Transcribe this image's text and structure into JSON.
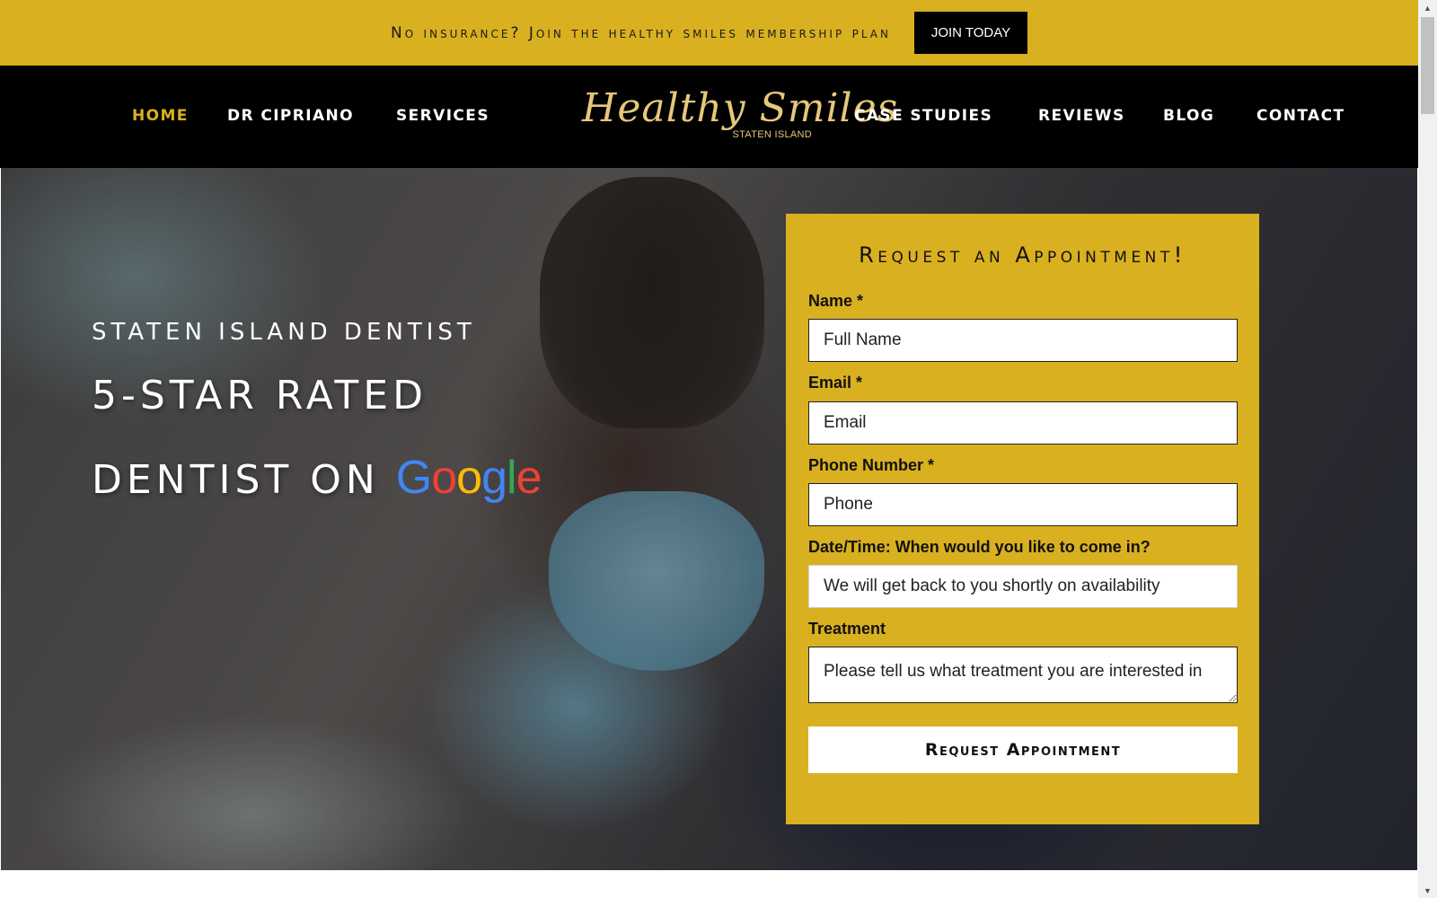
{
  "banner": {
    "text": "No insurance? Join the healthy smiles membership plan",
    "cta_label": "JOIN TODAY"
  },
  "nav": {
    "left_items": [
      {
        "label": "HOME",
        "active": true
      },
      {
        "label": "DR CIPRIANO"
      },
      {
        "label": "SERVICES"
      }
    ],
    "logo": {
      "script": "Healthy Smiles",
      "sub": "STATEN ISLAND"
    },
    "right_items": [
      {
        "label": "CASE STUDIES"
      },
      {
        "label": "REVIEWS"
      },
      {
        "label": "BLOG"
      },
      {
        "label": "CONTACT"
      }
    ]
  },
  "hero": {
    "eyebrow": "Staten Island Dentist",
    "line1": "5-Star Rated",
    "line2": "Dentist on",
    "google": [
      "G",
      "o",
      "o",
      "g",
      "l",
      "e"
    ]
  },
  "form": {
    "title": "Request an Appointment!",
    "name_label": "Name *",
    "name_placeholder": "Full Name",
    "email_label": "Email *",
    "email_placeholder": "Email",
    "phone_label": "Phone Number *",
    "phone_placeholder": "Phone",
    "datetime_label": "Date/Time: When would you like to come in?",
    "datetime_placeholder": "We will get back to you shortly on availability",
    "treatment_label": "Treatment",
    "treatment_placeholder": "Please tell us what treatment you are interested in",
    "submit_label": "Request Appointment"
  },
  "colors": {
    "accent": "#d9b01f",
    "nav_bg": "#000000",
    "google_blue": "#4285F4",
    "google_red": "#EA4335",
    "google_yellow": "#FBBC05",
    "google_green": "#34A853"
  },
  "scrollbar": {
    "up_icon": "triangle-up",
    "down_icon": "triangle-down"
  }
}
